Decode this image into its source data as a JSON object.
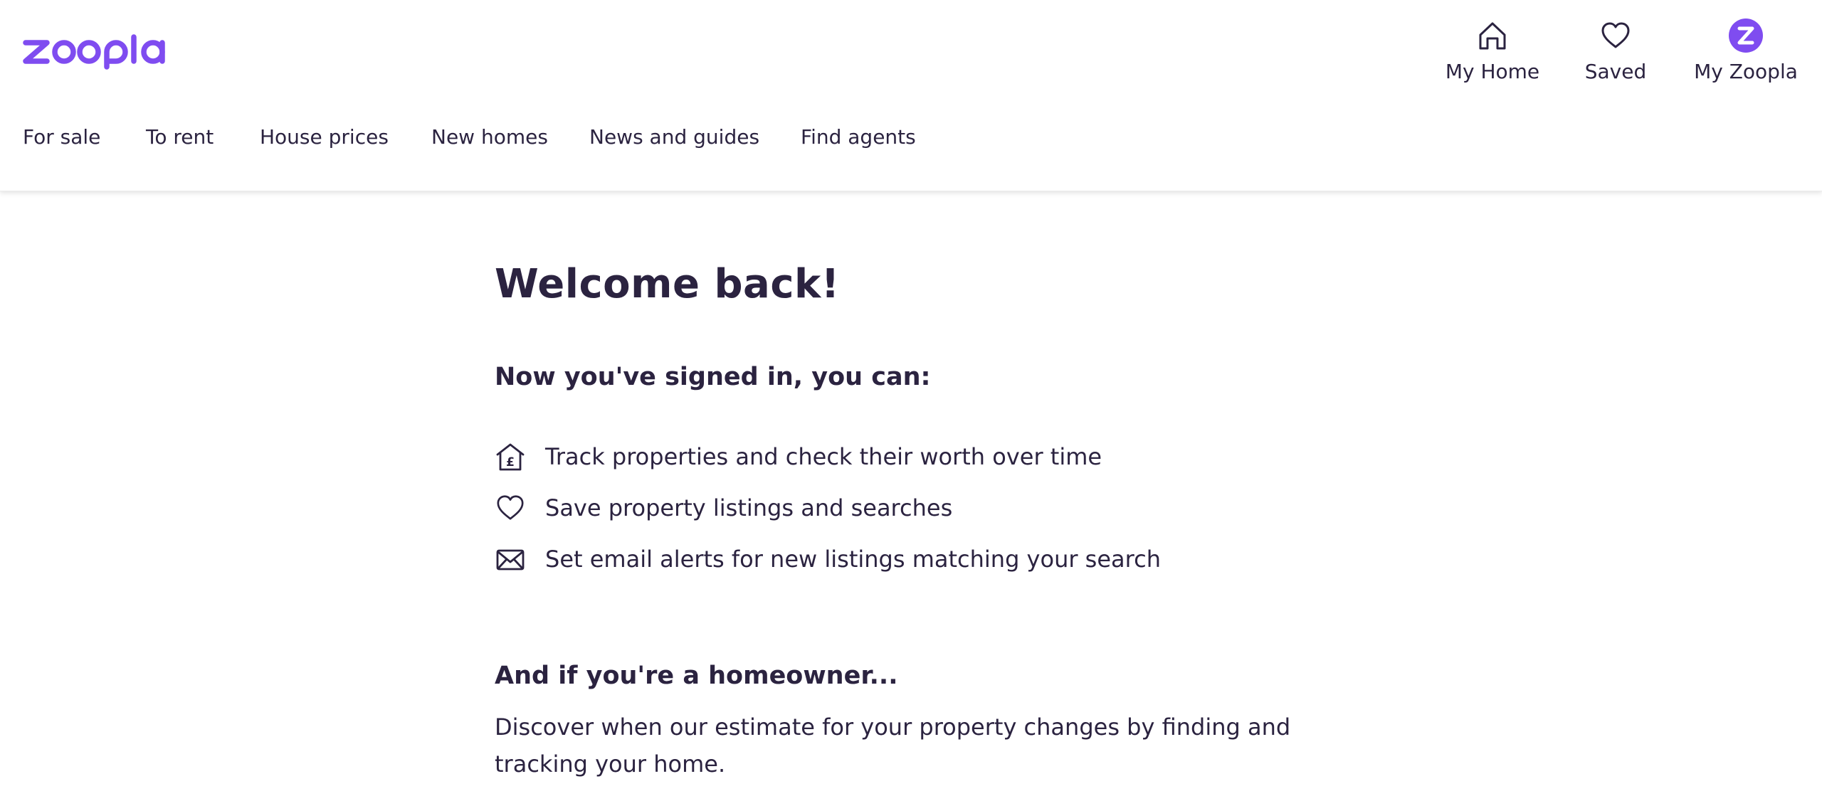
{
  "brand": {
    "logo_text": "zoopla",
    "accent_color": "#7f4cf0",
    "text_color": "#2b2340"
  },
  "user_nav": {
    "my_home": {
      "label": "My Home",
      "icon": "house-icon"
    },
    "saved": {
      "label": "Saved",
      "icon": "heart-icon"
    },
    "my_zoopla": {
      "label": "My Zoopla",
      "icon": "zoopla-avatar-icon"
    }
  },
  "main_nav": {
    "items": [
      {
        "label": "For sale"
      },
      {
        "label": "To rent"
      },
      {
        "label": "House prices"
      },
      {
        "label": "New homes"
      },
      {
        "label": "News and guides"
      },
      {
        "label": "Find agents"
      }
    ]
  },
  "main": {
    "title": "Welcome back!",
    "subtitle": "Now you've signed in, you can:",
    "benefits": [
      {
        "text": "Track properties and check their worth over time",
        "icon": "house-pound-icon"
      },
      {
        "text": "Save property listings and searches",
        "icon": "heart-icon"
      },
      {
        "text": "Set email alerts for new listings matching your search",
        "icon": "envelope-icon"
      }
    ],
    "homeowner_heading": "And if you're a homeowner...",
    "homeowner_body": "Discover when our estimate for your property changes by finding and tracking your home."
  }
}
